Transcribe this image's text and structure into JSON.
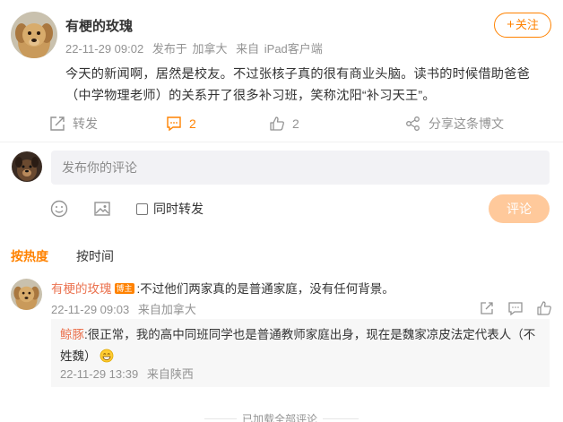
{
  "post": {
    "author": "有梗的玫瑰",
    "timestamp": "22-11-29 09:02",
    "posted_in_prefix": "发布于",
    "location": "加拿大",
    "source_prefix": "来自",
    "source": "iPad客户端",
    "follow_label": "关注",
    "text": "今天的新闻啊，居然是校友。不过张核子真的很有商业头脑。读书的时候借助爸爸（中学物理老师）的关系开了很多补习班，笑称沈阳“补习天王”。",
    "actions": {
      "repost_label": "转发",
      "comment_count": "2",
      "like_count": "2",
      "share_label": "分享这条博文"
    }
  },
  "composer": {
    "placeholder": "发布你的评论",
    "repost_checkbox_label": "同时转发",
    "submit_label": "评论"
  },
  "sort": {
    "tabs": [
      "按热度",
      "按时间"
    ]
  },
  "comment": {
    "user": "有梗的玫瑰",
    "badge": "博主",
    "text": ":不过他们两家真的是普通家庭，没有任何背景。",
    "timestamp": "22-11-29 09:03",
    "location": "来自加拿大",
    "reply": {
      "user": "鲸豚",
      "text": ":很正常，我的高中同班同学也是普通教师家庭出身，现在是魏家凉皮法定代表人（不姓魏）",
      "emoji": "smile-emoji",
      "timestamp": "22-11-29 13:39",
      "location": "来自陕西"
    }
  },
  "footer": {
    "end_text": "已加载全部评论"
  },
  "colors": {
    "accent": "#ff8200",
    "username": "#eb7350",
    "meta": "#939393",
    "submit_disabled": "#ffc99b"
  }
}
